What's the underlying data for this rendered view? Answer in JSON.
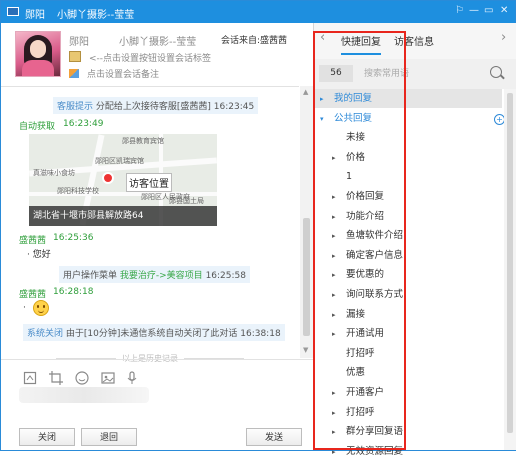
{
  "window": {
    "location": "郧阳",
    "title": "小脚丫摄影--莹莹",
    "controls": [
      "⚐",
      "—",
      "▭",
      "✕"
    ]
  },
  "profile": {
    "name": "郧阳",
    "nickname": "小脚丫摄影--莹莹",
    "session_source": "会话来自:盛茜茜",
    "tag_hint": "<--点击设置按钮设置会话标签",
    "note_hint": "点击设置会话备注"
  },
  "chat": {
    "sys1": {
      "prefix": "客服提示",
      "text": "分配给上次接待客服[盛茜茜]",
      "time": "16:23:45"
    },
    "auto": {
      "sender": "自动获取",
      "time": "16:23:49"
    },
    "map": {
      "labels": [
        "郧县教育宾馆",
        "郧阳区凯瑞宾馆",
        "真滋味小食坊",
        "郧阳科技学校",
        "郧阳区人民政府",
        "郧县国土局"
      ],
      "callout": "访客位置",
      "address": "湖北省十堰市郧县解放路64"
    },
    "msg1": {
      "sender": "盛茜茜",
      "time": "16:25:36",
      "text": "· 您好"
    },
    "sys2": {
      "prefix": "用户操作菜单",
      "link": "我要治疗->美容项目",
      "time": "16:25:58"
    },
    "msg2": {
      "sender": "盛茜茜",
      "time": "16:28:18",
      "bullet": "·"
    },
    "sys3": {
      "prefix": "系统关闭",
      "text": "由于[10分钟]未通信系统自动关闭了此对话",
      "time": "16:38:18"
    },
    "history": "以上是历史记录"
  },
  "buttons": {
    "close": "关闭",
    "back": "退回",
    "send": "发送"
  },
  "right_panel": {
    "tabs": [
      "快捷回复",
      "访客信息"
    ],
    "count": "56",
    "search_placeholder": "搜索常用语",
    "tree": [
      {
        "label": "我的回复",
        "arrow": "▸",
        "level": 0,
        "style": "blue-hl"
      },
      {
        "label": "公共回复",
        "arrow": "▾",
        "level": 0,
        "style": "blue"
      },
      {
        "label": "未接",
        "arrow": "",
        "level": 1
      },
      {
        "label": "价格",
        "arrow": "▸",
        "level": 1
      },
      {
        "label": "1",
        "arrow": "",
        "level": 1
      },
      {
        "label": "价格回复",
        "arrow": "▸",
        "level": 1
      },
      {
        "label": "功能介绍",
        "arrow": "▸",
        "level": 1
      },
      {
        "label": "鱼塘软件介绍",
        "arrow": "▸",
        "level": 1
      },
      {
        "label": "确定客户信息",
        "arrow": "▸",
        "level": 1
      },
      {
        "label": "要优惠的",
        "arrow": "▸",
        "level": 1
      },
      {
        "label": "询问联系方式",
        "arrow": "▸",
        "level": 1
      },
      {
        "label": "漏接",
        "arrow": "▸",
        "level": 1
      },
      {
        "label": "开通试用",
        "arrow": "▸",
        "level": 1
      },
      {
        "label": "打招呼",
        "arrow": "",
        "level": 1
      },
      {
        "label": "优惠",
        "arrow": "",
        "level": 1
      },
      {
        "label": "开通客户",
        "arrow": "▸",
        "level": 1
      },
      {
        "label": "打招呼",
        "arrow": "▸",
        "level": 1
      },
      {
        "label": "群分享回复语",
        "arrow": "▸",
        "level": 1
      },
      {
        "label": "无效资源回复",
        "arrow": "▸",
        "level": 1
      }
    ]
  },
  "colors": {
    "titlebar": "#1e8fdf",
    "highlight_box": "#e8261d",
    "sender": "#2e9e3a",
    "link": "#2e8ad8"
  }
}
